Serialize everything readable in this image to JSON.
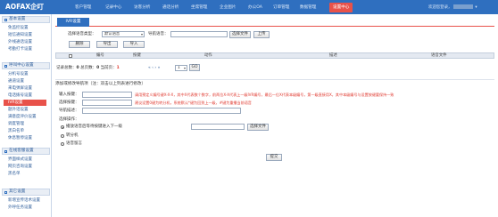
{
  "app": {
    "logo": "AOFAX企叮"
  },
  "nav": {
    "items": [
      "客户管理",
      "记录中心",
      "访客分析",
      "通话分析",
      "坐席管理",
      "企业图片",
      "办公OA",
      "订单管理",
      "数据管理",
      "设置中心"
    ],
    "active_index": 9,
    "welcome": "欢迎您登录，"
  },
  "sidebar": {
    "sections": [
      {
        "title": "基本设置",
        "items": [
          "免监控设置",
          "短信通知设置",
          "外线通话设置",
          "考勤打卡设置"
        ]
      },
      {
        "title": "呼叫中心设置",
        "items": [
          "分机号设置",
          "通道设置",
          "来电弹屏设置",
          "电话拨号设置",
          "IVR设置",
          "题外话设置",
          "满意度评价设置",
          "调度管理",
          "黑白名单",
          "休息暂停设置"
        ]
      },
      {
        "title": "在线客服设置",
        "items": [
          "界面样式设置",
          "网页咨询设置",
          "黑名单"
        ]
      },
      {
        "title": "其它设置",
        "items": [
          "新增宣传话术设置",
          "外呼任务设置"
        ]
      }
    ],
    "active_item": "IVR设置"
  },
  "tab": {
    "label": "IVR设置"
  },
  "filter": {
    "type_label": "选择语音类型：",
    "type_value": "默认语音",
    "name_label": "导航语音：",
    "name_value": "",
    "choose_file": "选择文件",
    "upload": "上传"
  },
  "toolbar": {
    "delete": "删除",
    "export": "导出",
    "import": "导入"
  },
  "table": {
    "columns": [
      "",
      "编号",
      "按键",
      "动作",
      "描述",
      "语音文件"
    ]
  },
  "pager": {
    "summary_prefix": "记录总数：",
    "total": "0",
    "pages_label": "总页数：",
    "pages": "0",
    "current_label": "当前页：",
    "current": "1",
    "nav_arrows": "« ‹ › »",
    "page_input": "1",
    "go": "GO"
  },
  "form": {
    "title": "添加或修改导航项（注：双击以上列表进行修改）",
    "key_label": "输入按键：",
    "key_value": "",
    "key_hint": "请用预定义编号键X-X-X，其中X代表数个数字，前两位X-X代表上一级IVR编号，最后一位X代表本级编号，第一级直接用X，其中本级编号与设置按键要保持一致",
    "action_label": "选择按键：",
    "action_value": "",
    "action_hint": "建议设置0键为转分机，系统默认*键为回到上一级，#键为重播当前语音",
    "desc_label": "导航描述：",
    "desc_value": "",
    "op_label": "选择操作：",
    "options": [
      "播放语音后等待按键进入下一级",
      "转分机",
      "语音留言"
    ],
    "selected_option": 0,
    "file_value": "",
    "choose_file": "选择文件",
    "submit": "提交"
  }
}
